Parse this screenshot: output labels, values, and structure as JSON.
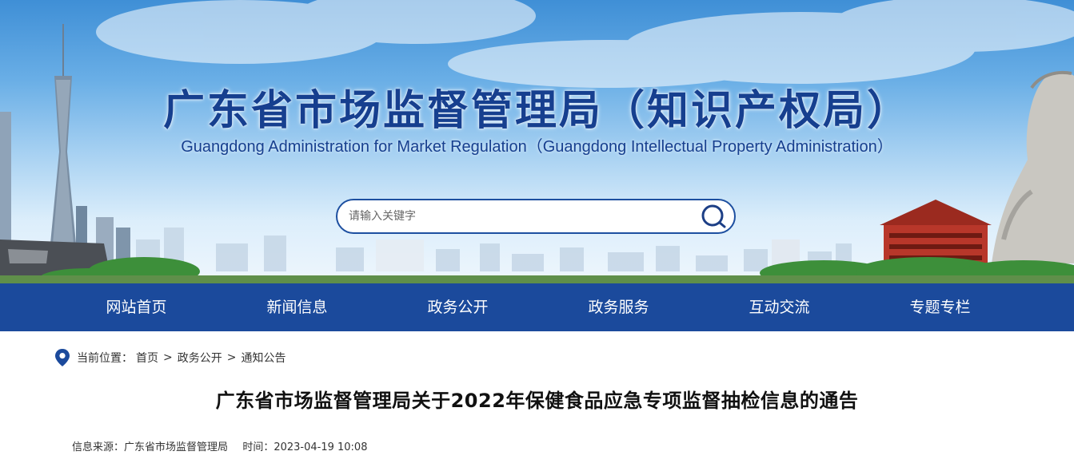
{
  "header": {
    "title": "广东省市场监督管理局（知识产权局）",
    "subtitle": "Guangdong Administration for Market Regulation（Guangdong Intellectual Property Administration）"
  },
  "search": {
    "placeholder": "请输入关键字",
    "icon": "search-icon"
  },
  "nav": {
    "items": [
      {
        "label": "网站首页"
      },
      {
        "label": "新闻信息"
      },
      {
        "label": "政务公开"
      },
      {
        "label": "政务服务"
      },
      {
        "label": "互动交流"
      },
      {
        "label": "专题专栏"
      }
    ]
  },
  "breadcrumb": {
    "icon": "location-pin-icon",
    "prefix": "当前位置：",
    "items": [
      "首页",
      "政务公开",
      "通知公告"
    ],
    "separator": ">"
  },
  "article": {
    "title": "广东省市场监督管理局关于2022年保健食品应急专项监督抽检信息的通告",
    "source_label": "信息来源：",
    "source": "广东省市场监督管理局",
    "time_label": "时间：",
    "time": "2023-04-19 10:08"
  },
  "colors": {
    "brand_blue": "#1b4a9c",
    "title_blue": "#163f8f"
  }
}
